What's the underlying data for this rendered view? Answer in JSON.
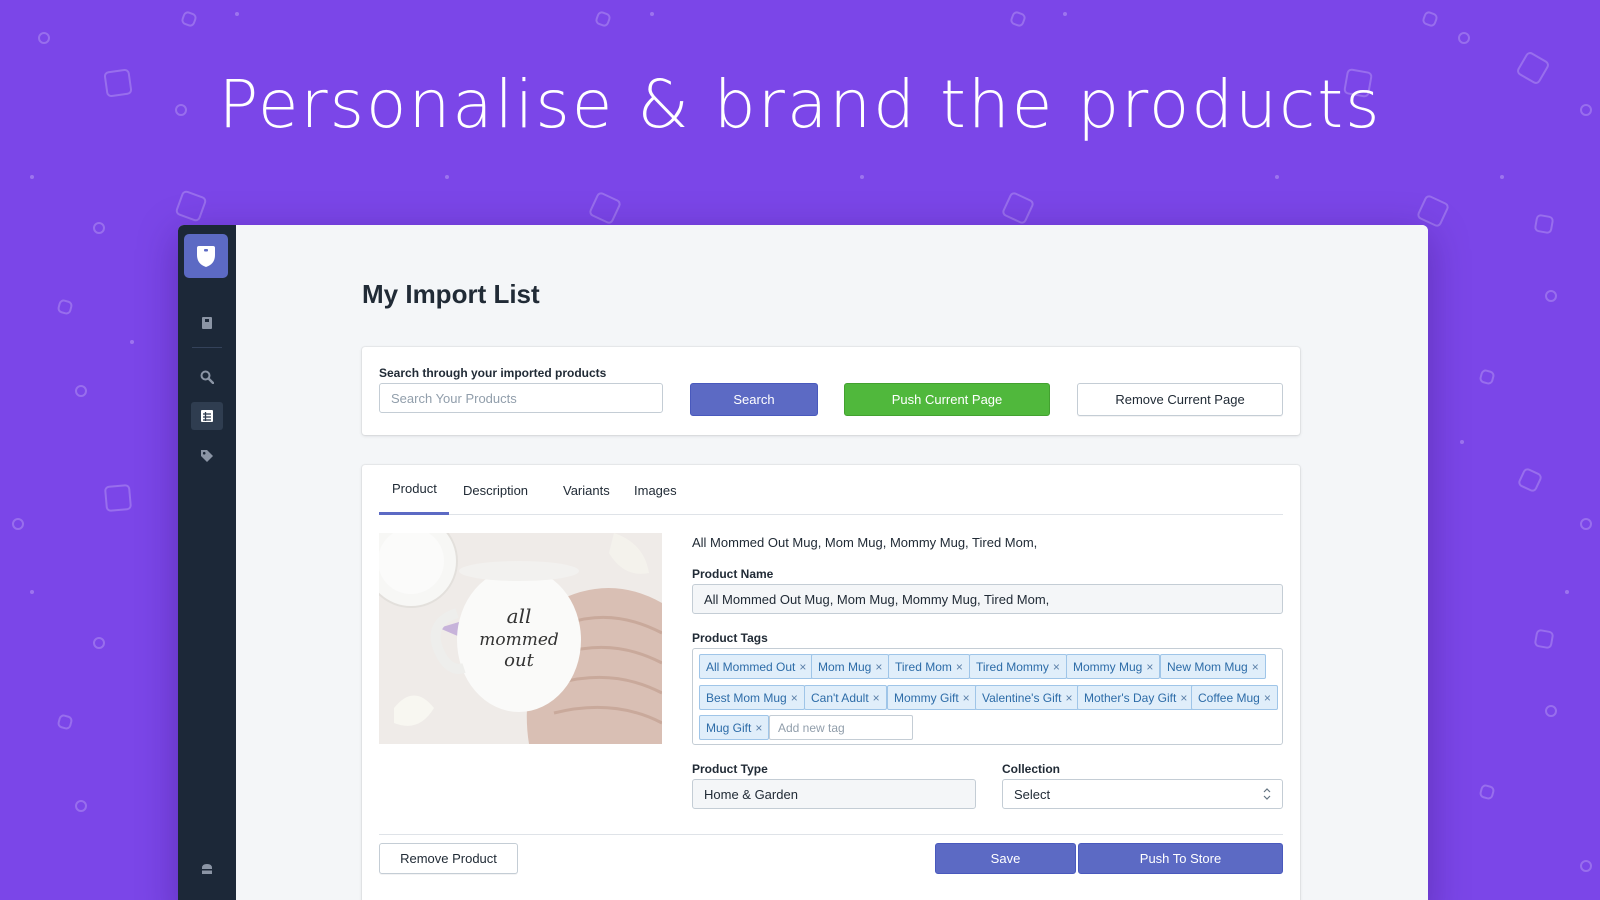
{
  "hero": {
    "title": "Personalise & brand the products"
  },
  "sidebar": {
    "logo_icon": "app-logo-icon",
    "items": [
      {
        "icon": "book-icon",
        "active": false
      },
      {
        "icon": "search-icon",
        "active": false
      },
      {
        "icon": "list-icon",
        "active": true
      },
      {
        "icon": "tag-icon",
        "active": false
      }
    ],
    "bottom_icon": "store-icon"
  },
  "page": {
    "title": "My Import List"
  },
  "search": {
    "label": "Search through your imported products",
    "placeholder": "Search Your Products",
    "search_button": "Search",
    "push_page_button": "Push Current Page",
    "remove_page_button": "Remove Current Page"
  },
  "product": {
    "tabs": [
      "Product",
      "Description",
      "Variants",
      "Images"
    ],
    "active_tab": "Product",
    "summary": "All Mommed Out Mug, Mom Mug, Mommy Mug, Tired Mom,",
    "image_text": "all mommed out",
    "name_label": "Product Name",
    "name_value": "All Mommed Out Mug, Mom Mug, Mommy Mug, Tired Mom,",
    "tags_label": "Product Tags",
    "tags": [
      "All Mommed Out",
      "Mom Mug",
      "Tired Mom",
      "Tired Mommy",
      "Mommy Mug",
      "New Mom Mug",
      "Best Mom Mug",
      "Can't Adult",
      "Mommy Gift",
      "Valentine's Gift",
      "Mother's Day Gift",
      "Coffee Mug",
      "Mug Gift"
    ],
    "tag_remove_symbol": "×",
    "new_tag_placeholder": "Add new tag",
    "type_label": "Product Type",
    "type_value": "Home & Garden",
    "collection_label": "Collection",
    "collection_value": "Select",
    "remove_button": "Remove Product",
    "save_button": "Save",
    "push_button": "Push To Store"
  },
  "colors": {
    "background": "#7b46e8",
    "primary": "#5c6ac4",
    "success": "#50b83c",
    "sidebar": "#1c2838",
    "tag_bg": "#e0eefa"
  }
}
